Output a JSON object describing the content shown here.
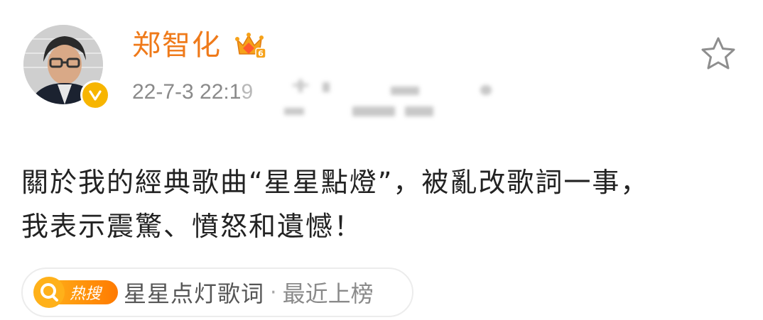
{
  "post": {
    "author": "郑智化",
    "timestamp": "22-7-3 22:1",
    "timestamp_partial": "9",
    "content_lines": [
      "關於我的經典歌曲“星星點燈”，被亂改歌詞一事，",
      "我表示震驚、憤怒和遺憾！"
    ]
  },
  "hot_search": {
    "icon_label": "热搜",
    "topic": "星星点灯歌词",
    "separator": "·",
    "rank": "最近上榜"
  },
  "icons": {
    "avatar": "avatar",
    "verified": "verified-v-icon",
    "crown": "crown-icon",
    "favorite": "star-icon",
    "hot_search": "search-icon"
  },
  "colors": {
    "author": "#ef7a1a",
    "timestamp": "#8a8a8a",
    "content": "#222222",
    "verified_badge": "#f7b500",
    "hot_search_icon": "#ff8a00"
  }
}
